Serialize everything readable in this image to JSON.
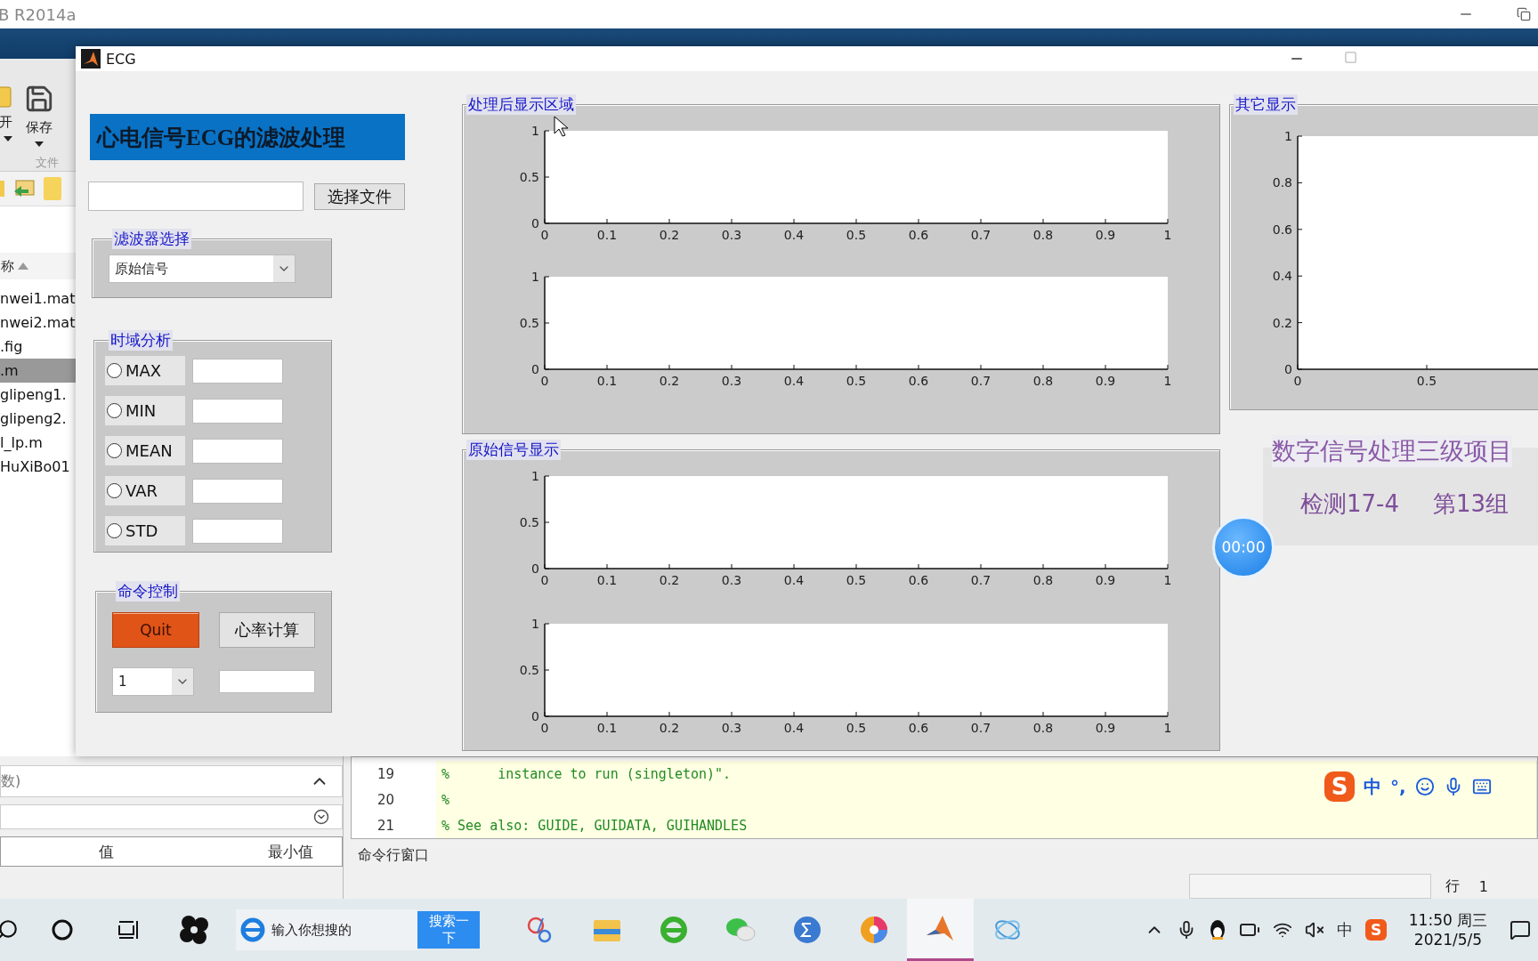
{
  "matlab_window": {
    "title": "B R2014a"
  },
  "home_toolbar": {
    "buttons": [
      {
        "label": "开"
      },
      {
        "label": "保存"
      }
    ],
    "section_label": "文件"
  },
  "file_browser": {
    "header": "称",
    "files": [
      {
        "name": "nwei1.mat",
        "selected": false
      },
      {
        "name": "nwei2.mat",
        "selected": false
      },
      {
        "name": ".fig",
        "selected": false
      },
      {
        "name": ".m",
        "selected": true
      },
      {
        "name": "glipeng1.",
        "selected": false
      },
      {
        "name": "glipeng2.",
        "selected": false
      },
      {
        "name": "l_lp.m",
        "selected": false
      },
      {
        "name": "HuXiBo01",
        "selected": false
      }
    ]
  },
  "workspace": {
    "title": "数)",
    "columns": [
      "值",
      "最小值"
    ]
  },
  "editor": {
    "lines": [
      {
        "number": "19",
        "code": "%      instance to run (singleton)\"."
      },
      {
        "number": "20",
        "code": "%"
      },
      {
        "number": "21",
        "code": "% See also: GUIDE, GUIDATA, GUIHANDLES"
      }
    ]
  },
  "command_window": {
    "title": "命令行窗口"
  },
  "status_bar": {
    "row_label": "行",
    "row_value": "1"
  },
  "ecg_window": {
    "title": "ECG",
    "banner": "心电信号ECG的滤波处理",
    "file_button": "选择文件",
    "filter_panel": {
      "title": "滤波器选择",
      "dropdown_value": "原始信号"
    },
    "stats_panel": {
      "title": "时域分析",
      "options": [
        {
          "label": "MAX",
          "selected": false
        },
        {
          "label": "MIN",
          "selected": false
        },
        {
          "label": "MEAN",
          "selected": false
        },
        {
          "label": "VAR",
          "selected": false
        },
        {
          "label": "STD",
          "selected": false
        }
      ]
    },
    "command_panel": {
      "title": "命令控制",
      "quit_button": "Quit",
      "heart_rate_button": "心率计算",
      "dropdown_value": "1"
    },
    "processed_panel": {
      "title": "处理后显示区域",
      "charts": [
        {
          "chart_data": {
            "type": "line",
            "xlim": [
              0,
              1
            ],
            "ylim": [
              0,
              1
            ],
            "xticks": [
              0,
              0.1,
              0.2,
              0.3,
              0.4,
              0.5,
              0.6,
              0.7,
              0.8,
              0.9,
              1
            ],
            "yticks": [
              0,
              0.5,
              1
            ]
          }
        },
        {
          "chart_data": {
            "type": "line",
            "xlim": [
              0,
              1
            ],
            "ylim": [
              0,
              1
            ],
            "xticks": [
              0,
              0.1,
              0.2,
              0.3,
              0.4,
              0.5,
              0.6,
              0.7,
              0.8,
              0.9,
              1
            ],
            "yticks": [
              0,
              0.5,
              1
            ]
          }
        }
      ]
    },
    "original_panel": {
      "title": "原始信号显示",
      "charts": [
        {
          "chart_data": {
            "type": "line",
            "xlim": [
              0,
              1
            ],
            "ylim": [
              0,
              1
            ],
            "xticks": [
              0,
              0.1,
              0.2,
              0.3,
              0.4,
              0.5,
              0.6,
              0.7,
              0.8,
              0.9,
              1
            ],
            "yticks": [
              0,
              0.5,
              1
            ]
          }
        },
        {
          "chart_data": {
            "type": "line",
            "xlim": [
              0,
              1
            ],
            "ylim": [
              0,
              1
            ],
            "xticks": [
              0,
              0.1,
              0.2,
              0.3,
              0.4,
              0.5,
              0.6,
              0.7,
              0.8,
              0.9,
              1
            ],
            "yticks": [
              0,
              0.5,
              1
            ]
          }
        }
      ]
    },
    "other_panel": {
      "title": "其它显示",
      "chart_data": {
        "type": "line",
        "xlim": [
          0,
          1
        ],
        "ylim": [
          0,
          1
        ],
        "xticks": [
          0,
          0.5
        ],
        "yticks": [
          0,
          0.2,
          0.4,
          0.6,
          0.8,
          1
        ]
      }
    },
    "project_info": {
      "title": "数字信号处理三级项目",
      "class_label": "检测17-4",
      "group_label": "第13组"
    }
  },
  "recorder_timer": "00:00",
  "ime_toolbar": {
    "logo": "S",
    "mode": "中",
    "punctuation": "°,"
  },
  "taskbar": {
    "search_placeholder": "输入你想搜的",
    "search_button": "搜索一下",
    "tray_ime": "中",
    "tray_logo": "S",
    "time": "11:50 周三",
    "date": "2021/5/5"
  }
}
